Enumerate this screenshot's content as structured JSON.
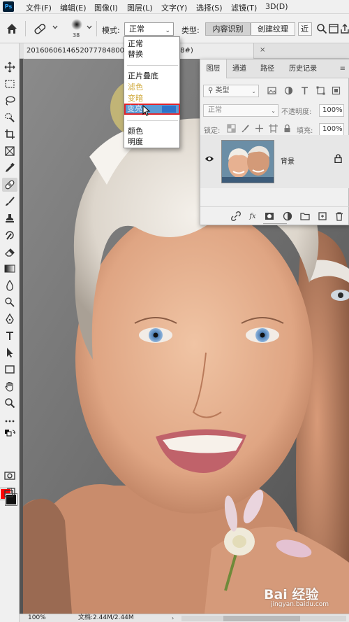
{
  "app": {
    "logo_text": "Ps"
  },
  "menubar": {
    "items": [
      "文件(F)",
      "编辑(E)",
      "图像(I)",
      "图层(L)",
      "文字(Y)",
      "选择(S)",
      "滤镜(T)",
      "3D(D)"
    ]
  },
  "options_bar": {
    "brush_size": "38",
    "mode_label": "模式:",
    "mode_value": "正常",
    "type_label": "类型:",
    "type_options": [
      "内容识别",
      "创建纹理",
      "近"
    ]
  },
  "document": {
    "tab_title": "2016060614652077784800...@ 100%(RGB/8#)",
    "close_glyph": "×"
  },
  "blend_dropdown": {
    "groups": [
      [
        "正常",
        "替换"
      ],
      [
        "正片叠底",
        "滤色",
        "变暗",
        "变亮"
      ],
      [
        "颜色",
        "明度"
      ]
    ],
    "highlighted": "变亮"
  },
  "layers_panel": {
    "tabs": [
      "图层",
      "通道",
      "路径",
      "历史记录"
    ],
    "active_tab": "图层",
    "filter_label": "类型",
    "blend_mode": "正常",
    "opacity_label": "不透明度:",
    "opacity_value": "100%",
    "lock_label": "锁定:",
    "fill_label": "填充:",
    "fill_value": "100%",
    "layers": [
      {
        "name": "背景",
        "visible": true,
        "locked": true
      }
    ]
  },
  "status_bar": {
    "zoom": "100%",
    "doc_info": "文档:2.44M/2.44M"
  },
  "watermark": {
    "text": "Bai  经验",
    "url": "jingyan.baidu.com"
  },
  "colors": {
    "foreground": "#ff0000",
    "background": "#111111",
    "highlight": "#5b9bd5",
    "highlight_border": "#e0252b"
  }
}
